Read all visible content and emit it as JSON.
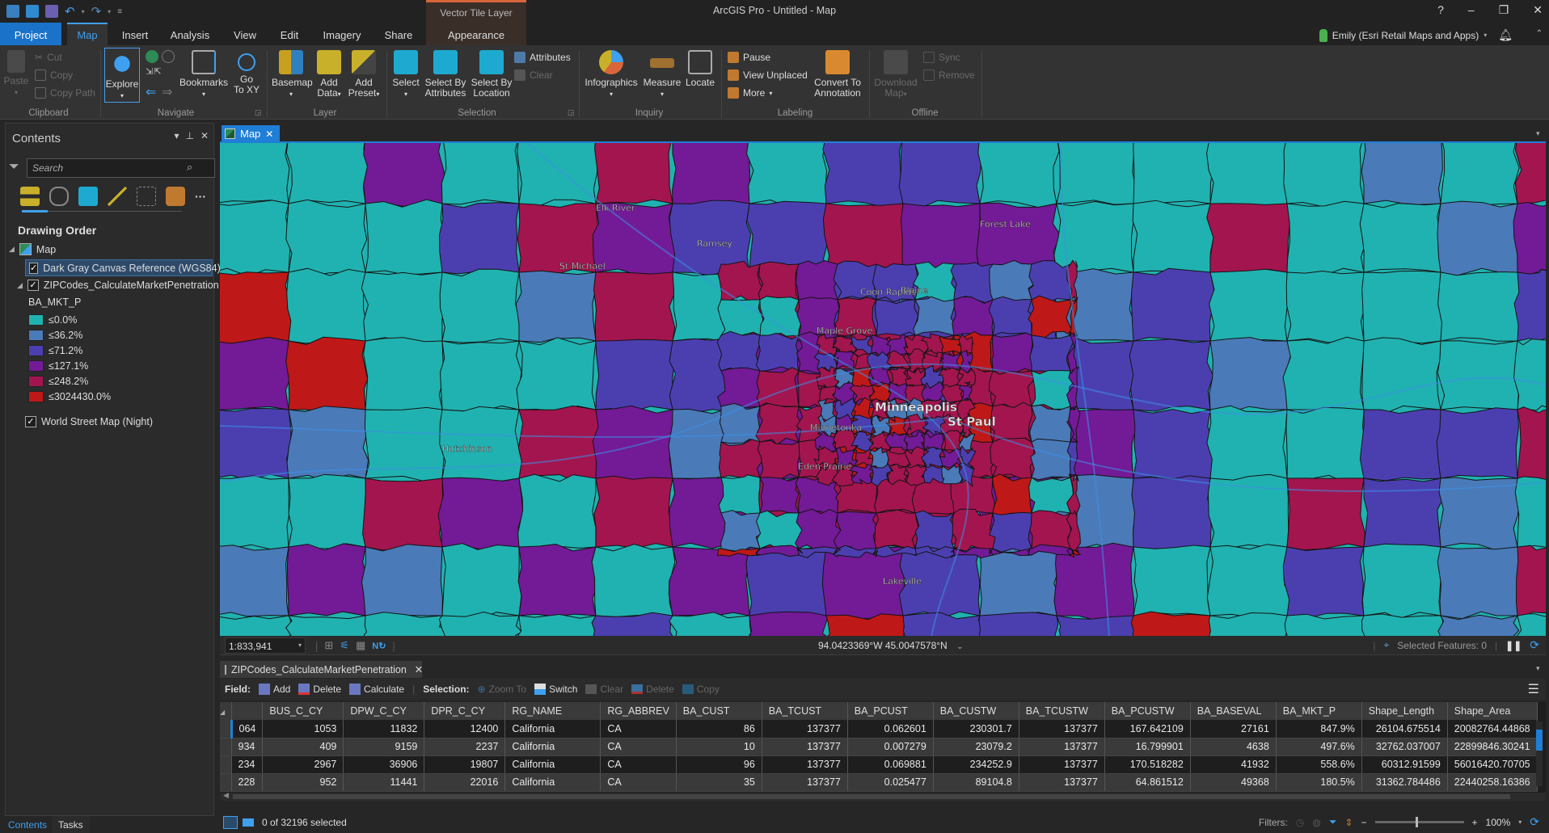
{
  "app": {
    "title": "ArcGIS Pro - Untitled - Map",
    "context_tab_group": "Vector Tile Layer"
  },
  "window_controls": {
    "help": "?",
    "minimize": "–",
    "restore": "❐",
    "close": "✕"
  },
  "ribbon_tabs": [
    {
      "label": "Project"
    },
    {
      "label": "Map"
    },
    {
      "label": "Insert"
    },
    {
      "label": "Analysis"
    },
    {
      "label": "View"
    },
    {
      "label": "Edit"
    },
    {
      "label": "Imagery"
    },
    {
      "label": "Share"
    },
    {
      "label": "Appearance"
    }
  ],
  "user": {
    "name": "Emily (Esri Retail Maps and Apps)"
  },
  "ribbon": {
    "clipboard": {
      "label": "Clipboard",
      "paste": "Paste",
      "cut": "Cut",
      "copy": "Copy",
      "copy_path": "Copy Path"
    },
    "navigate": {
      "label": "Navigate",
      "explore": "Explore",
      "bookmarks": "Bookmarks",
      "go_to_xy_1": "Go",
      "go_to_xy_2": "To XY"
    },
    "layer": {
      "label": "Layer",
      "basemap": "Basemap",
      "add_data_1": "Add",
      "add_data_2": "Data",
      "add_preset_1": "Add",
      "add_preset_2": "Preset"
    },
    "selection": {
      "label": "Selection",
      "select": "Select",
      "select_by_attr_1": "Select By",
      "select_by_attr_2": "Attributes",
      "select_by_loc_1": "Select By",
      "select_by_loc_2": "Location",
      "attributes": "Attributes",
      "clear": "Clear"
    },
    "inquiry": {
      "label": "Inquiry",
      "infographics": "Infographics",
      "measure": "Measure",
      "locate": "Locate"
    },
    "labeling": {
      "label": "Labeling",
      "pause": "Pause",
      "view_unplaced": "View Unplaced",
      "more": "More",
      "convert_1": "Convert To",
      "convert_2": "Annotation"
    },
    "offline": {
      "label": "Offline",
      "download_1": "Download",
      "download_2": "Map",
      "sync": "Sync",
      "remove": "Remove"
    }
  },
  "contents": {
    "title": "Contents",
    "search_placeholder": "Search",
    "section": "Drawing Order",
    "map_label": "Map",
    "layers": [
      {
        "name": "Dark Gray Canvas Reference (WGS84)",
        "checked": true,
        "selected": true
      },
      {
        "name": "ZIPCodes_CalculateMarketPenetration",
        "checked": true
      },
      {
        "name": "World Street Map (Night)",
        "checked": true
      }
    ],
    "legend_field": "BA_MKT_P",
    "legend": [
      {
        "label": "≤0.0%",
        "color": "#20b2b0"
      },
      {
        "label": "≤36.2%",
        "color": "#4a7ab8"
      },
      {
        "label": "≤71.2%",
        "color": "#4b3fb0"
      },
      {
        "label": "≤127.1%",
        "color": "#731a96"
      },
      {
        "label": "≤248.2%",
        "color": "#a3154f"
      },
      {
        "label": "≤3024430.0%",
        "color": "#bf1818"
      }
    ],
    "bottom_tabs": [
      {
        "label": "Contents"
      },
      {
        "label": "Tasks"
      }
    ]
  },
  "map": {
    "tab_label": "Map",
    "scale": "1:833,941",
    "coordinates": "94.0423369°W 45.0047578°N",
    "selected_features": "Selected Features: 0",
    "place_labels": [
      {
        "text": "Elk River"
      },
      {
        "text": "Ramsey"
      },
      {
        "text": "Forest Lake"
      },
      {
        "text": "St Michael"
      },
      {
        "text": "Coon Rapids"
      },
      {
        "text": "Blaine"
      },
      {
        "text": "Maple Grove"
      },
      {
        "text": "Minneapolis"
      },
      {
        "text": "St Paul"
      },
      {
        "text": "Minnetonka"
      },
      {
        "text": "Hutchinson"
      },
      {
        "text": "Eden Prairie"
      },
      {
        "text": "Lakeville"
      }
    ]
  },
  "attribute_table": {
    "tab_label": "ZIPCodes_CalculateMarketPenetration",
    "toolbar": {
      "field_label": "Field:",
      "add": "Add",
      "delete": "Delete",
      "calculate": "Calculate",
      "selection_label": "Selection:",
      "zoom_to": "Zoom To",
      "switch": "Switch",
      "clear": "Clear",
      "sel_delete": "Delete",
      "copy": "Copy"
    },
    "columns": [
      "",
      "BUS_C_CY",
      "DPW_C_CY",
      "DPR_C_CY",
      "RG_NAME",
      "RG_ABBREV",
      "BA_CUST",
      "BA_TCUST",
      "BA_PCUST",
      "BA_CUSTW",
      "BA_TCUSTW",
      "BA_PCUSTW",
      "BA_BASEVAL",
      "BA_MKT_P",
      "Shape_Length",
      "Shape_Area"
    ],
    "rows": [
      [
        "064",
        "1053",
        "11832",
        "12400",
        "California",
        "CA",
        "86",
        "137377",
        "0.062601",
        "230301.7",
        "137377",
        "167.642109",
        "27161",
        "847.9%",
        "26104.675514",
        "20082764.44868"
      ],
      [
        "934",
        "409",
        "9159",
        "2237",
        "California",
        "CA",
        "10",
        "137377",
        "0.007279",
        "23079.2",
        "137377",
        "16.799901",
        "4638",
        "497.6%",
        "32762.037007",
        "22899846.30241"
      ],
      [
        "234",
        "2967",
        "36906",
        "19807",
        "California",
        "CA",
        "96",
        "137377",
        "0.069881",
        "234252.9",
        "137377",
        "170.518282",
        "41932",
        "558.6%",
        "60312.91599",
        "56016420.70705"
      ],
      [
        "228",
        "952",
        "11441",
        "22016",
        "California",
        "CA",
        "35",
        "137377",
        "0.025477",
        "89104.8",
        "137377",
        "64.861512",
        "49368",
        "180.5%",
        "31362.784486",
        "22440258.16386"
      ]
    ],
    "selected_count": "0 of 32196 selected",
    "filters_label": "Filters:",
    "zoom_level": "100%"
  }
}
